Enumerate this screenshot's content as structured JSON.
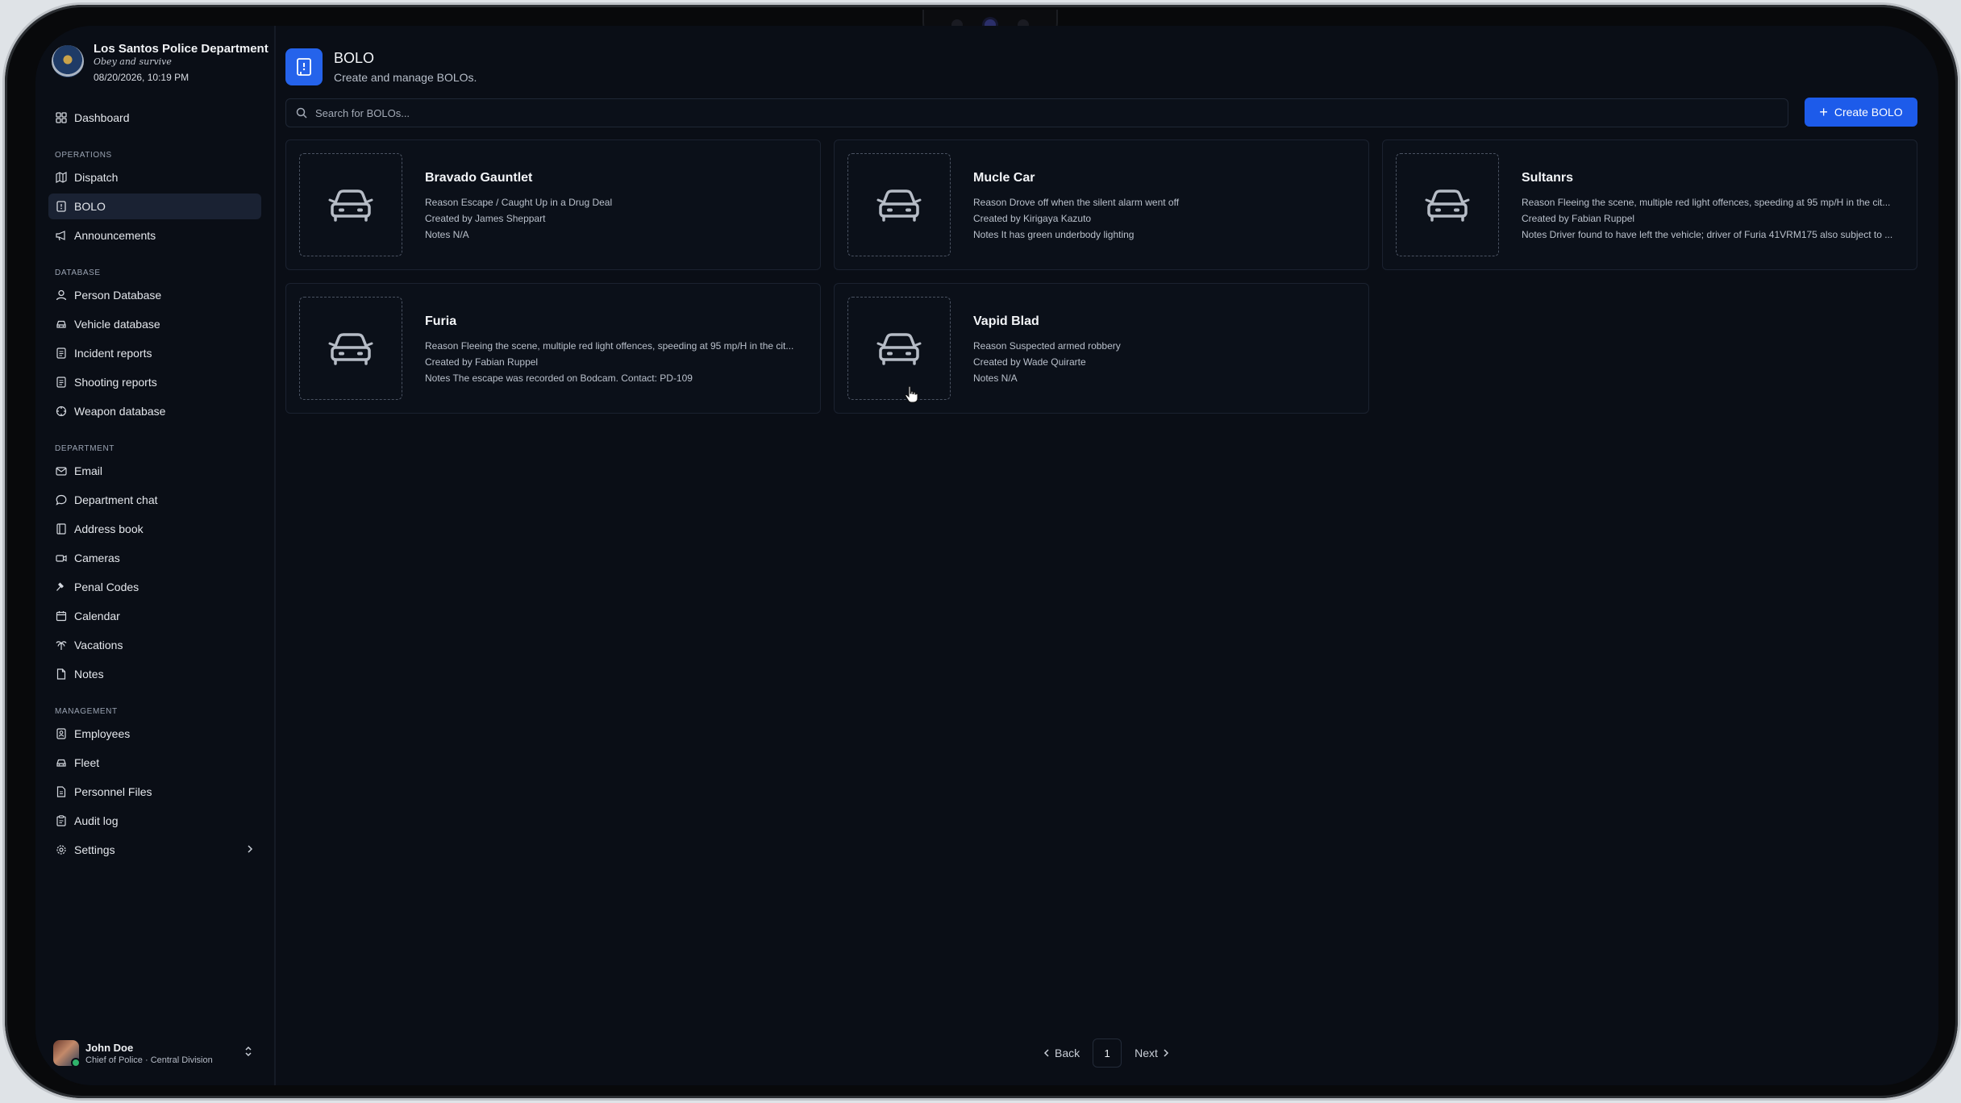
{
  "org": {
    "name": "Los Santos Police Department",
    "motto": "Obey and survive",
    "datetime": "08/20/2026, 10:19 PM"
  },
  "sidebar": {
    "top": [
      {
        "label": "Dashboard",
        "icon": "dashboard-icon"
      }
    ],
    "sections": [
      {
        "title": "OPERATIONS",
        "items": [
          {
            "label": "Dispatch",
            "icon": "map-icon"
          },
          {
            "label": "BOLO",
            "icon": "bolo-icon",
            "active": true
          },
          {
            "label": "Announcements",
            "icon": "megaphone-icon"
          }
        ]
      },
      {
        "title": "DATABASE",
        "items": [
          {
            "label": "Person Database",
            "icon": "person-icon"
          },
          {
            "label": "Vehicle database",
            "icon": "car-icon"
          },
          {
            "label": "Incident reports",
            "icon": "report-icon"
          },
          {
            "label": "Shooting reports",
            "icon": "report-icon"
          },
          {
            "label": "Weapon database",
            "icon": "crosshair-icon"
          }
        ]
      },
      {
        "title": "DEPARTMENT",
        "items": [
          {
            "label": "Email",
            "icon": "mail-icon"
          },
          {
            "label": "Department chat",
            "icon": "chat-icon"
          },
          {
            "label": "Address book",
            "icon": "book-icon"
          },
          {
            "label": "Cameras",
            "icon": "camera-icon"
          },
          {
            "label": "Penal Codes",
            "icon": "gavel-icon"
          },
          {
            "label": "Calendar",
            "icon": "calendar-icon"
          },
          {
            "label": "Vacations",
            "icon": "palm-tree-icon"
          },
          {
            "label": "Notes",
            "icon": "note-icon"
          }
        ]
      },
      {
        "title": "MANAGEMENT",
        "items": [
          {
            "label": "Employees",
            "icon": "employees-icon"
          },
          {
            "label": "Fleet",
            "icon": "car-icon"
          },
          {
            "label": "Personnel Files",
            "icon": "file-icon"
          },
          {
            "label": "Audit log",
            "icon": "clipboard-icon"
          },
          {
            "label": "Settings",
            "icon": "gear-icon",
            "chevron": true
          }
        ]
      }
    ]
  },
  "user": {
    "name": "John Doe",
    "role": "Chief of Police · Central Division"
  },
  "page": {
    "title": "BOLO",
    "subtitle": "Create and manage BOLOs.",
    "search_placeholder": "Search for BOLOs...",
    "create_label": "Create BOLO"
  },
  "bolos": [
    {
      "title": "Bravado Gauntlet",
      "reason": "Reason Escape / Caught Up in a Drug Deal",
      "created": "Created by James Sheppart",
      "notes": "Notes N/A"
    },
    {
      "title": "Mucle Car",
      "reason": "Reason Drove off when the silent alarm went off",
      "created": "Created by Kirigaya Kazuto",
      "notes": "Notes It has green underbody lighting"
    },
    {
      "title": "Sultanrs",
      "reason": "Reason Fleeing the scene, multiple red light offences, speeding at 95 mp/H in the cit...",
      "created": "Created by Fabian Ruppel",
      "notes": "Notes Driver found to have left the vehicle; driver of Furia 41VRM175 also subject to ..."
    },
    {
      "title": "Furia",
      "reason": "Reason Fleeing the scene, multiple red light offences, speeding at 95 mp/H in the cit...",
      "created": "Created by Fabian Ruppel",
      "notes": "Notes The escape was recorded on Bodcam. Contact: PD-109"
    },
    {
      "title": "Vapid Blad",
      "reason": "Reason Suspected armed robbery",
      "created": "Created by Wade Quirarte",
      "notes": "Notes N/A"
    }
  ],
  "pagination": {
    "back": "Back",
    "page": "1",
    "next": "Next"
  },
  "colors": {
    "accent": "#1d5bea",
    "background": "#0a0e16",
    "active_nav": "#1a2233"
  }
}
